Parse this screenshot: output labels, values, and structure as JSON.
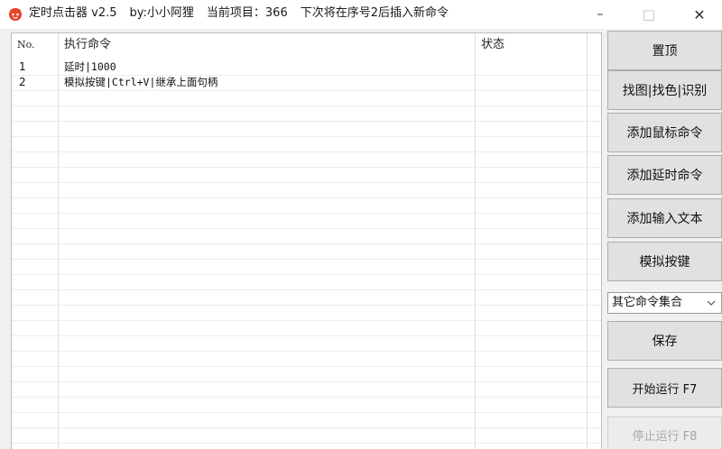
{
  "window": {
    "app_name": "定时点击器 v2.5",
    "author": "by:小小阿狸",
    "current_project": "当前项目：366",
    "insert_hint": "下次将在序号2后插入新命令",
    "controls": {
      "minimize_glyph": "–",
      "maximize_glyph": "□",
      "close_glyph": "✕"
    }
  },
  "list": {
    "columns": {
      "no": "No.",
      "command": "执行命令",
      "status": "状态"
    },
    "rows": [
      {
        "no": "1",
        "command": "延时|1000",
        "status": ""
      },
      {
        "no": "2",
        "command": "模拟按键|Ctrl+V|继承上面句柄",
        "status": ""
      }
    ]
  },
  "buttons": {
    "pin_top": "置顶",
    "find_image": "找图|找色|识别",
    "add_mouse": "添加鼠标命令",
    "add_delay": "添加延时命令",
    "add_text": "添加输入文本",
    "simulate_key": "模拟按键",
    "save": "保存",
    "start": "开始运行 F7",
    "stop": "停止运行 F8"
  },
  "dropdown": {
    "selected": "其它命令集合"
  },
  "colors": {
    "app_icon": "#e8412c",
    "button_face": "#e1e1e1",
    "disabled_text": "#a8a8a8"
  }
}
